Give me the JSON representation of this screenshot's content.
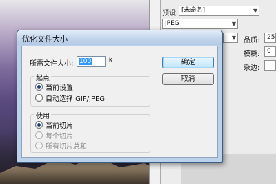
{
  "background_panel": {
    "preset_label": "预设:",
    "preset_value": "[未命名]",
    "format_value": "JPEG",
    "quality_label": "品质:",
    "quality_value": "25",
    "blur_label": "模糊:",
    "blur_value": "0",
    "matte_label": "杂边:"
  },
  "dialog": {
    "title": "优化文件大小",
    "target_size_label": "所需文件大小:",
    "target_size_value": "100",
    "target_size_unit": "K",
    "ok_label": "确定",
    "cancel_label": "取消",
    "start_group": {
      "title": "起点",
      "options": [
        {
          "label": "当前设置",
          "checked": true
        },
        {
          "label": "自动选择 GIF/JPEG",
          "checked": false
        }
      ]
    },
    "use_group": {
      "title": "使用",
      "options": [
        {
          "label": "当前切片",
          "checked": true,
          "enabled": true
        },
        {
          "label": "每个切片",
          "checked": false,
          "enabled": false
        },
        {
          "label": "所有切片总和",
          "checked": false,
          "enabled": false
        }
      ]
    }
  }
}
